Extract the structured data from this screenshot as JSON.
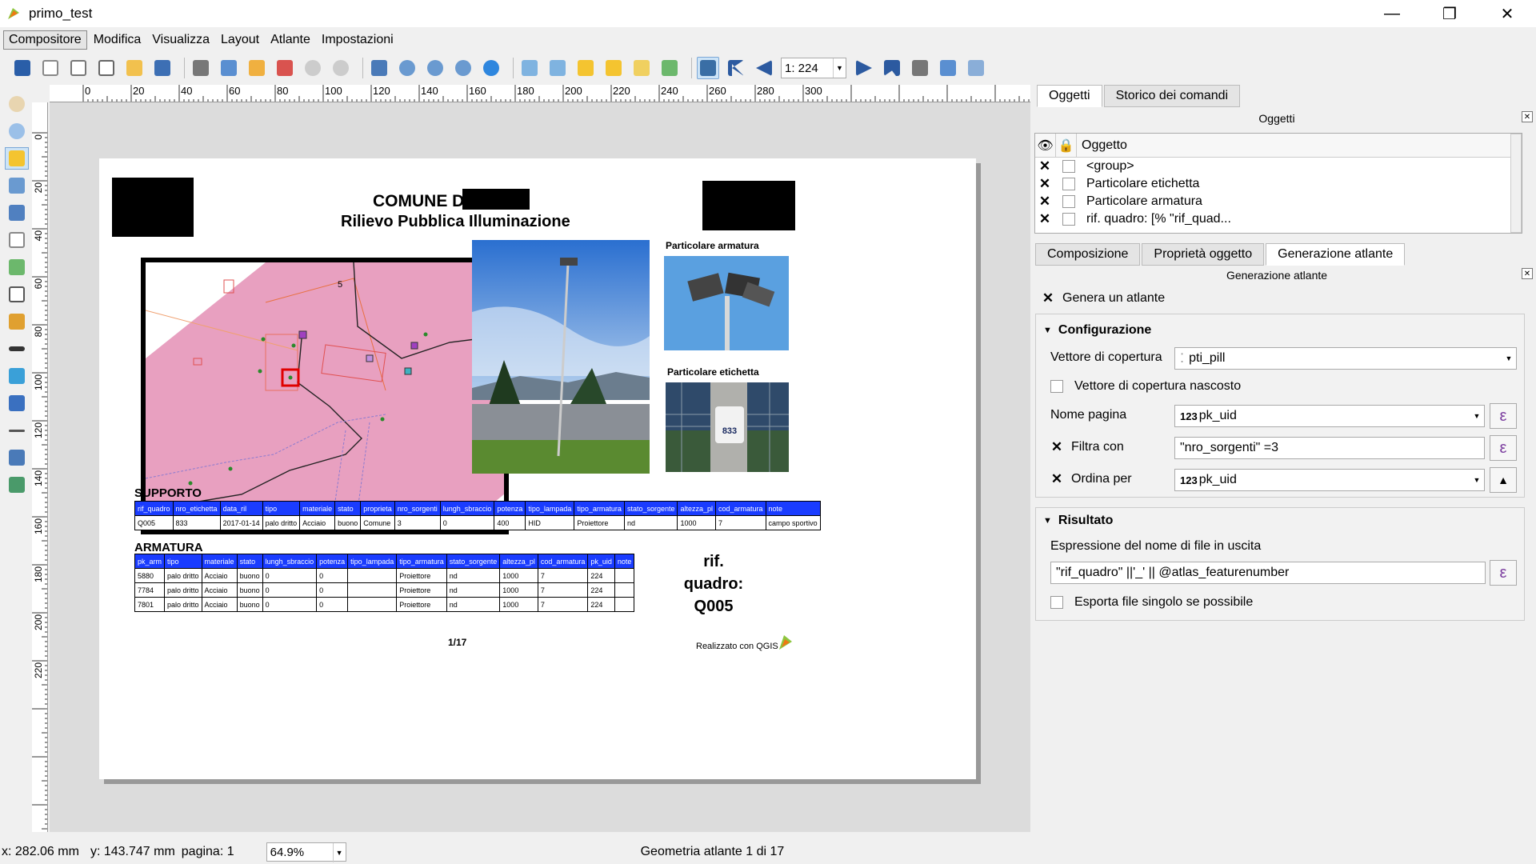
{
  "window": {
    "title": "primo_test",
    "minimize": "—",
    "maximize": "❐",
    "close": "✕"
  },
  "menu": [
    "Compositore",
    "Modifica",
    "Visualizza",
    "Layout",
    "Atlante",
    "Impostazioni"
  ],
  "toolbar": {
    "atlas_page": "1: 224"
  },
  "ruler_h": [
    "0",
    "20",
    "40",
    "60",
    "80",
    "100",
    "120",
    "140",
    "160",
    "180",
    "200",
    "220",
    "240",
    "260",
    "280",
    "300"
  ],
  "ruler_v": [
    "0",
    "20",
    "40",
    "60",
    "80",
    "100",
    "120",
    "140",
    "160",
    "180",
    "200",
    "220"
  ],
  "layout": {
    "title1": "COMUNE DI",
    "title2": "Rilievo Pubblica Illuminazione",
    "map_label": "5",
    "label_armatura": "Particolare armatura",
    "label_etichetta": "Particolare etichetta",
    "etichetta_number": "833",
    "supporto_title": "SUPPORTO",
    "supporto_headers": [
      "rif_quadro",
      "nro_etichetta",
      "data_ril",
      "tipo",
      "materiale",
      "stato",
      "proprieta",
      "nro_sorgenti",
      "lungh_sbraccio",
      "potenza",
      "tipo_lampada",
      "tipo_armatura",
      "stato_sorgente",
      "altezza_pl",
      "cod_armatura",
      "note"
    ],
    "supporto_rows": [
      [
        "Q005",
        "833",
        "2017-01-14",
        "palo dritto",
        "Acciaio",
        "buono",
        "Comune",
        "3",
        "0",
        "400",
        "HID",
        "Proiettore",
        "nd",
        "1000",
        "7",
        "campo sportivo"
      ]
    ],
    "armatura_title": "ARMATURA",
    "armatura_headers": [
      "pk_arm",
      "tipo",
      "materiale",
      "stato",
      "lungh_sbraccio",
      "potenza",
      "tipo_lampada",
      "tipo_armatura",
      "stato_sorgente",
      "altezza_pl",
      "cod_armatura",
      "pk_uid",
      "note"
    ],
    "armatura_rows": [
      [
        "5880",
        "palo dritto",
        "Acciaio",
        "buono",
        "0",
        "0",
        "",
        "Proiettore",
        "nd",
        "1000",
        "7",
        "224",
        ""
      ],
      [
        "7784",
        "palo dritto",
        "Acciaio",
        "buono",
        "0",
        "0",
        "",
        "Proiettore",
        "nd",
        "1000",
        "7",
        "224",
        ""
      ],
      [
        "7801",
        "palo dritto",
        "Acciaio",
        "buono",
        "0",
        "0",
        "",
        "Proiettore",
        "nd",
        "1000",
        "7",
        "224",
        ""
      ]
    ],
    "rif1": "rif. quadro:",
    "rif2": "Q005",
    "page_num": "1/17",
    "realizzato": "Realizzato con QGIS"
  },
  "dock": {
    "top_tabs": [
      "Oggetti",
      "Storico dei comandi"
    ],
    "objects_title": "Oggetti",
    "objects_col": "Oggetto",
    "objects": [
      "<group>",
      "Particolare etichetta",
      "Particolare armatura",
      "rif. quadro: [% \"rif_quad..."
    ],
    "bottom_tabs": [
      "Composizione",
      "Proprietà oggetto",
      "Generazione atlante"
    ],
    "atlas_title": "Generazione atlante",
    "genera": "Genera un atlante",
    "config_title": "Configurazione",
    "vettore_label": "Vettore di copertura",
    "vettore_value": "pti_pill",
    "nascosto_label": "Vettore di copertura nascosto",
    "nome_pagina_label": "Nome pagina",
    "nome_pagina_value": "pk_uid",
    "filtra_label": "Filtra con",
    "filtra_value": "\"nro_sorgenti\" =3",
    "ordina_label": "Ordina per",
    "ordina_value": "pk_uid",
    "type_badge": "123",
    "epsilon": "ε",
    "risultato_title": "Risultato",
    "espressione_label": "Espressione del nome di file in uscita",
    "espressione_value": "\"rif_quadro\" ||'_' || @atlas_featurenumber",
    "esporta_label": "Esporta file singolo se possibile"
  },
  "status": {
    "x": "x: 282.06 mm",
    "y": "y: 143.747 mm",
    "page": "pagina: 1",
    "zoom": "64.9%",
    "atlas": "Geometria atlante 1 di 17"
  },
  "colors": {
    "table_header": "#1a3cff",
    "map_fill": "#e8a0c0",
    "accent_purple": "#7a3c9e"
  }
}
